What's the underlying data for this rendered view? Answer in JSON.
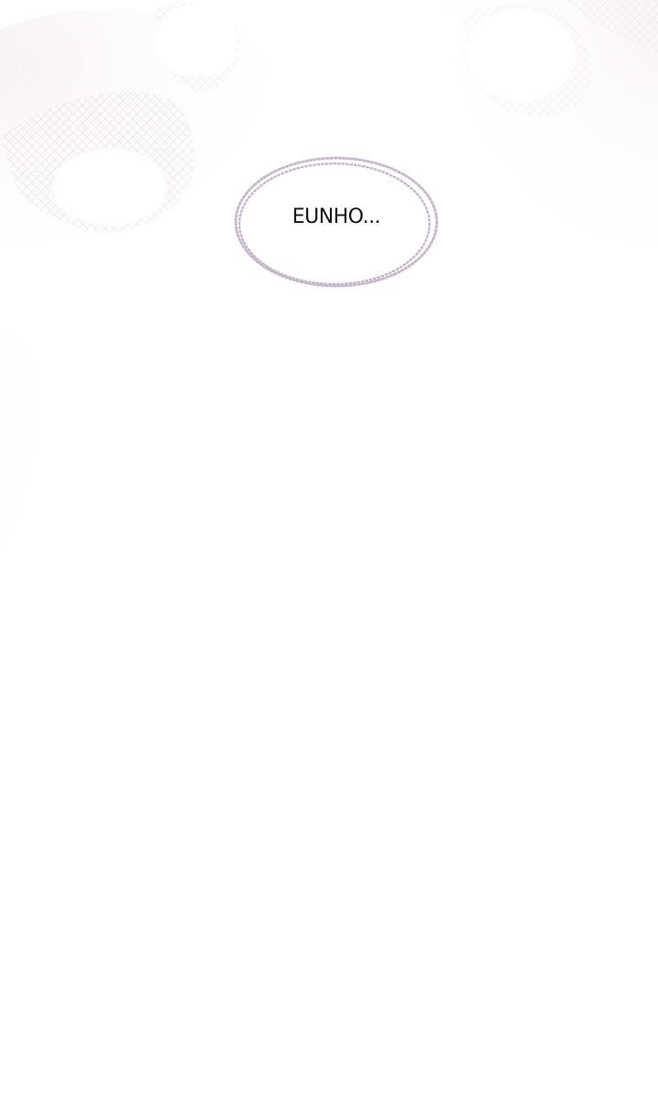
{
  "panel": {
    "speech_bubble": {
      "text": "EUNHO..."
    }
  },
  "colors": {
    "background": "#ffffff",
    "lace_tint": "#f3e6ea",
    "bubble_dots": "#c8b6cc",
    "text": "#111111"
  }
}
